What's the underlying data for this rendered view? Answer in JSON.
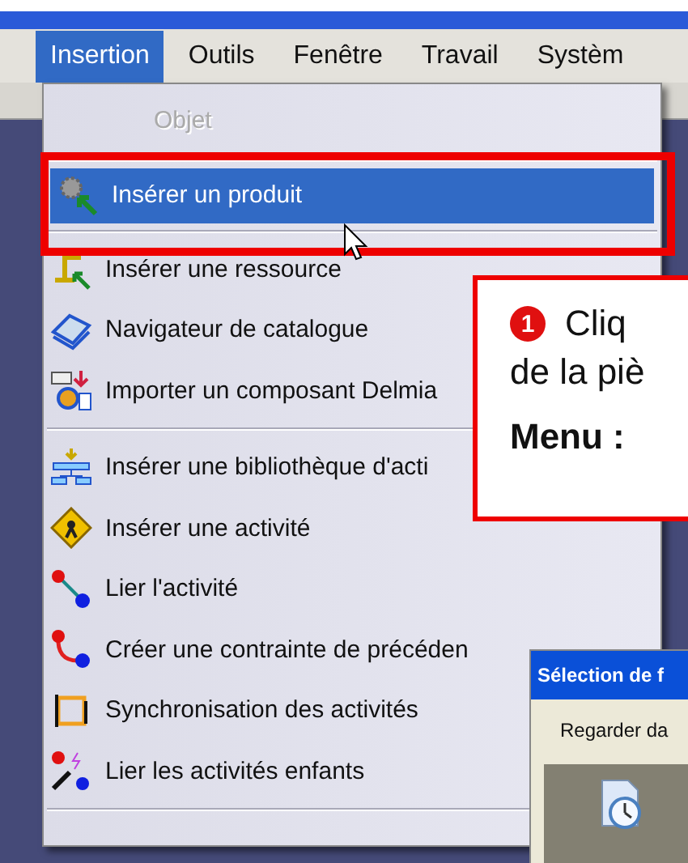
{
  "menu_bar": [
    {
      "label": "Insertion",
      "selected": true
    },
    {
      "label": "Outils",
      "selected": false
    },
    {
      "label": "Fenêtre",
      "selected": false
    },
    {
      "label": "Travail",
      "selected": false
    },
    {
      "label": "Systèm",
      "selected": false
    }
  ],
  "menu": [
    {
      "kind": "item",
      "label": "Objet",
      "disabled": true,
      "selected": false
    },
    {
      "kind": "separator"
    },
    {
      "kind": "item",
      "label": "Insérer un produit",
      "disabled": false,
      "selected": true
    },
    {
      "kind": "separator"
    },
    {
      "kind": "item",
      "label": "Insérer une ressource",
      "disabled": false,
      "selected": false
    },
    {
      "kind": "item",
      "label": "Navigateur de catalogue",
      "disabled": false,
      "selected": false
    },
    {
      "kind": "item",
      "label": "Importer un composant Delmia",
      "disabled": false,
      "selected": false
    },
    {
      "kind": "separator"
    },
    {
      "kind": "item",
      "label": "Insérer une bibliothèque d'acti",
      "disabled": false,
      "selected": false
    },
    {
      "kind": "item",
      "label": "Insérer une activité",
      "disabled": false,
      "selected": false
    },
    {
      "kind": "item",
      "label": "Lier l'activité",
      "disabled": false,
      "selected": false
    },
    {
      "kind": "item",
      "label": "Créer une contrainte de précéden",
      "disabled": false,
      "selected": false
    },
    {
      "kind": "item",
      "label": "Synchronisation des activités",
      "disabled": false,
      "selected": false
    },
    {
      "kind": "item",
      "label": "Lier les activités enfants",
      "disabled": false,
      "selected": false
    },
    {
      "kind": "separator"
    }
  ],
  "callout": {
    "badge": "1",
    "lines": [
      "Cliq",
      "de la piè"
    ],
    "menu_label": "Menu :"
  },
  "dialog": {
    "title": "Sélection de f",
    "look_in_label": "Regarder da"
  }
}
